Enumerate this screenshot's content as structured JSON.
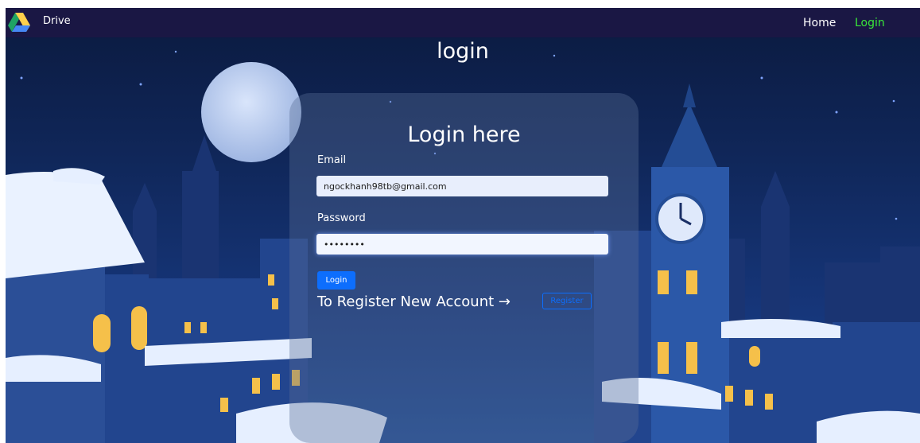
{
  "navbar": {
    "brand": "Drive",
    "home_label": "Home",
    "login_label": "Login",
    "logo_icon": "google-drive-logo-icon",
    "colors": {
      "background": "#1a1744",
      "active": "#39e639"
    }
  },
  "page": {
    "title": "login"
  },
  "login_form": {
    "heading": "Login here",
    "email_label": "Email",
    "email_value": "ngockhanh98tb@gmail.com",
    "password_label": "Password",
    "password_value": "********",
    "login_button": "Login",
    "register_prompt": "To Register New Account →",
    "register_button": "Register"
  },
  "colors": {
    "primary": "#0d6efd"
  }
}
